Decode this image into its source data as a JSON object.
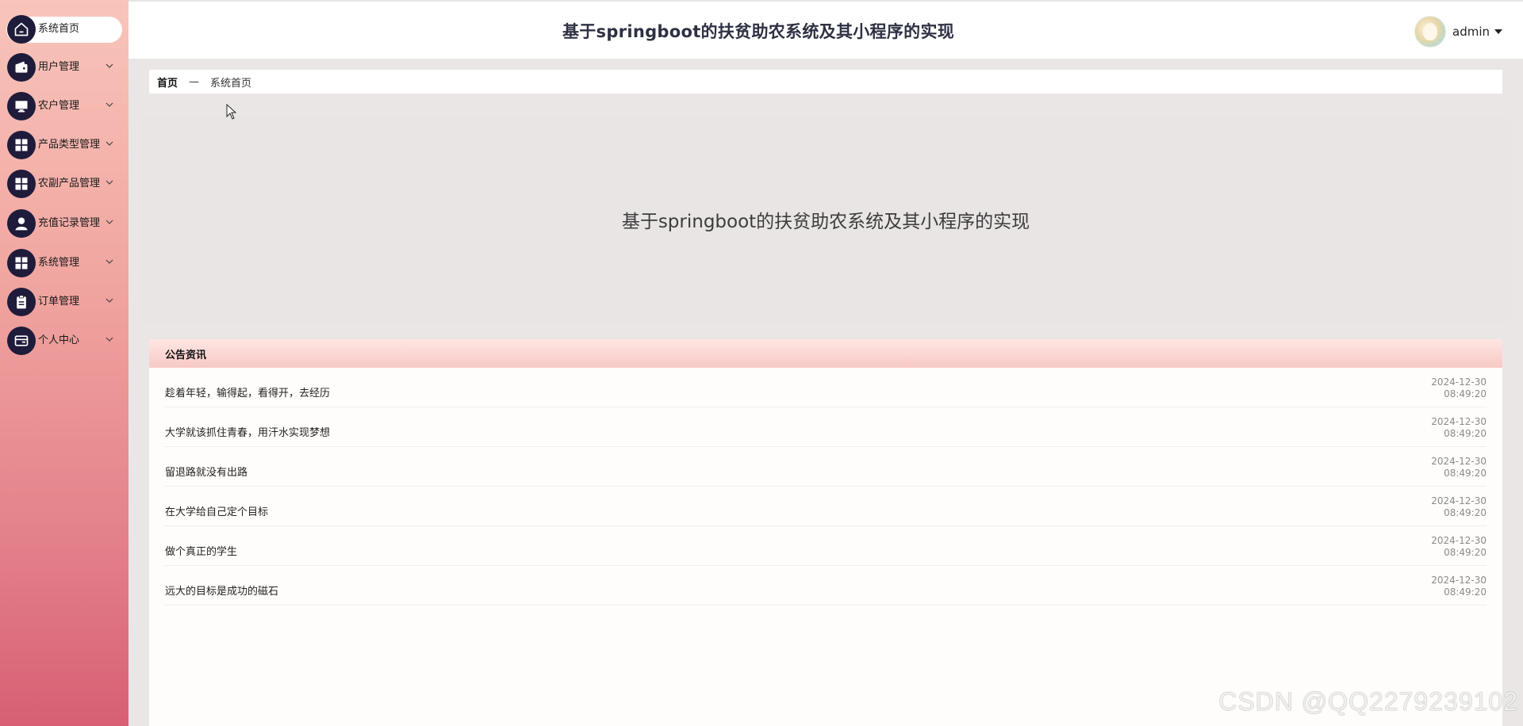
{
  "header": {
    "title": "基于springboot的扶贫助农系统及其小程序的实现",
    "username": "admin"
  },
  "sidebar": {
    "items": [
      {
        "label": "系统首页",
        "icon": "home-icon",
        "active": true
      },
      {
        "label": "用户管理",
        "icon": "wallet-icon",
        "active": false
      },
      {
        "label": "农户管理",
        "icon": "monitor-icon",
        "active": false
      },
      {
        "label": "产品类型管理",
        "icon": "grid-icon",
        "active": false
      },
      {
        "label": "农副产品管理",
        "icon": "grid-icon",
        "active": false
      },
      {
        "label": "充值记录管理",
        "icon": "user-icon",
        "active": false
      },
      {
        "label": "系统管理",
        "icon": "grid-icon",
        "active": false
      },
      {
        "label": "订单管理",
        "icon": "clipboard-icon",
        "active": false
      },
      {
        "label": "个人中心",
        "icon": "card-icon",
        "active": false
      }
    ]
  },
  "breadcrumb": {
    "home": "首页",
    "separator": "—",
    "current": "系统首页"
  },
  "banner": {
    "text": "基于springboot的扶贫助农系统及其小程序的实现"
  },
  "notices": {
    "header": "公告资讯",
    "items": [
      {
        "title": "趁着年轻，输得起，看得开，去经历",
        "date": "2024-12-30",
        "time": "08:49:20"
      },
      {
        "title": "大学就该抓住青春，用汗水实现梦想",
        "date": "2024-12-30",
        "time": "08:49:20"
      },
      {
        "title": "留退路就没有出路",
        "date": "2024-12-30",
        "time": "08:49:20"
      },
      {
        "title": "在大学给自己定个目标",
        "date": "2024-12-30",
        "time": "08:49:20"
      },
      {
        "title": "做个真正的学生",
        "date": "2024-12-30",
        "time": "08:49:20"
      },
      {
        "title": "远大的目标是成功的磁石",
        "date": "2024-12-30",
        "time": "08:49:20"
      }
    ]
  },
  "watermark": "CSDN @QQ2279239102",
  "colors": {
    "sidebar_top": "#f8c5bb",
    "sidebar_bottom": "#d75f73",
    "icon_circle": "#1f1b3a",
    "content_bg": "#eae6e6",
    "notice_header": "#f8c9c5"
  }
}
